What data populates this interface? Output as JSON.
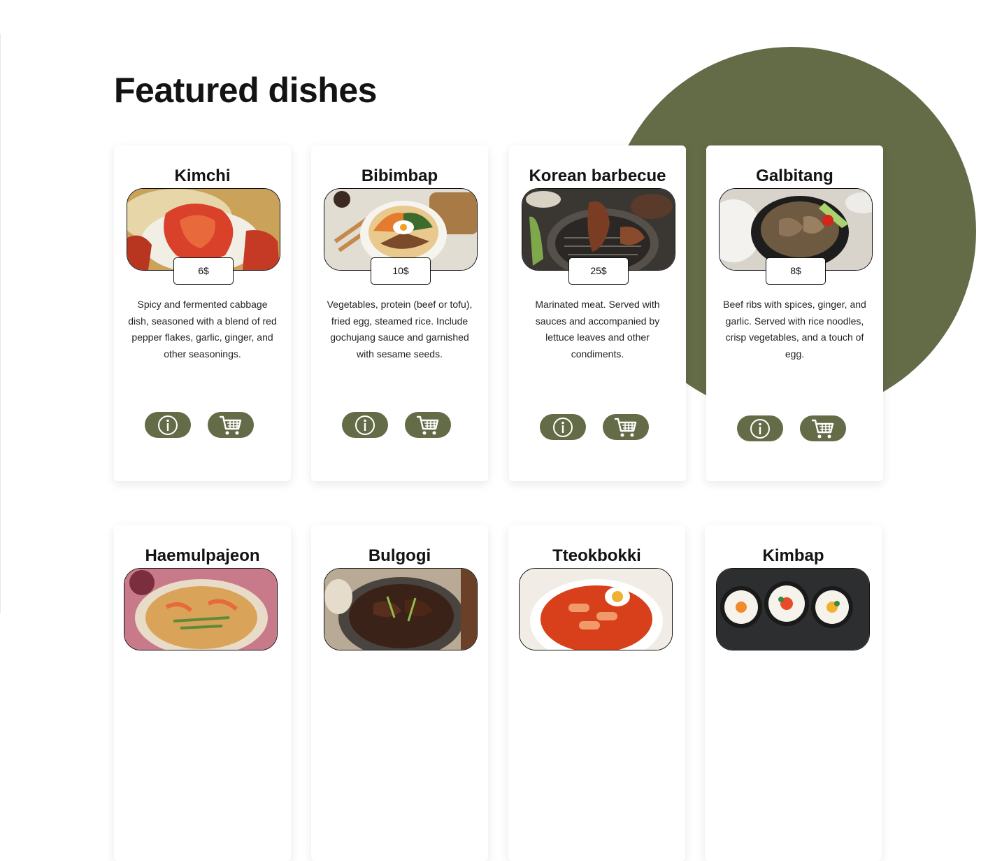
{
  "section": {
    "title": "Featured dishes"
  },
  "colors": {
    "accent": "#646b47",
    "card_bg": "#ffffff",
    "text": "#131313"
  },
  "icons": {
    "info": "info-circle-icon",
    "cart": "shopping-cart-icon"
  },
  "dishes": [
    {
      "name": "Kimchi",
      "price": "6$",
      "description": "Spicy and fermented cabbage dish, seasoned with a blend of red pepper flakes, garlic, ginger, and other seasonings."
    },
    {
      "name": "Bibimbap",
      "price": "10$",
      "description": "Vegetables, protein (beef or tofu), fried egg, steamed rice. Include gochujang sauce and garnished with sesame seeds."
    },
    {
      "name": "Korean barbecue",
      "price": "25$",
      "description": "Marinated meat. Served with sauces and accompanied by lettuce leaves and other condiments."
    },
    {
      "name": "Galbitang",
      "price": "8$",
      "description": "Beef ribs with spices, ginger, and garlic. Served with rice noodles, crisp vegetables, and a touch of egg."
    },
    {
      "name": "Haemulpajeon"
    },
    {
      "name": "Bulgogi"
    },
    {
      "name": "Tteokbokki"
    },
    {
      "name": "Kimbap"
    }
  ]
}
